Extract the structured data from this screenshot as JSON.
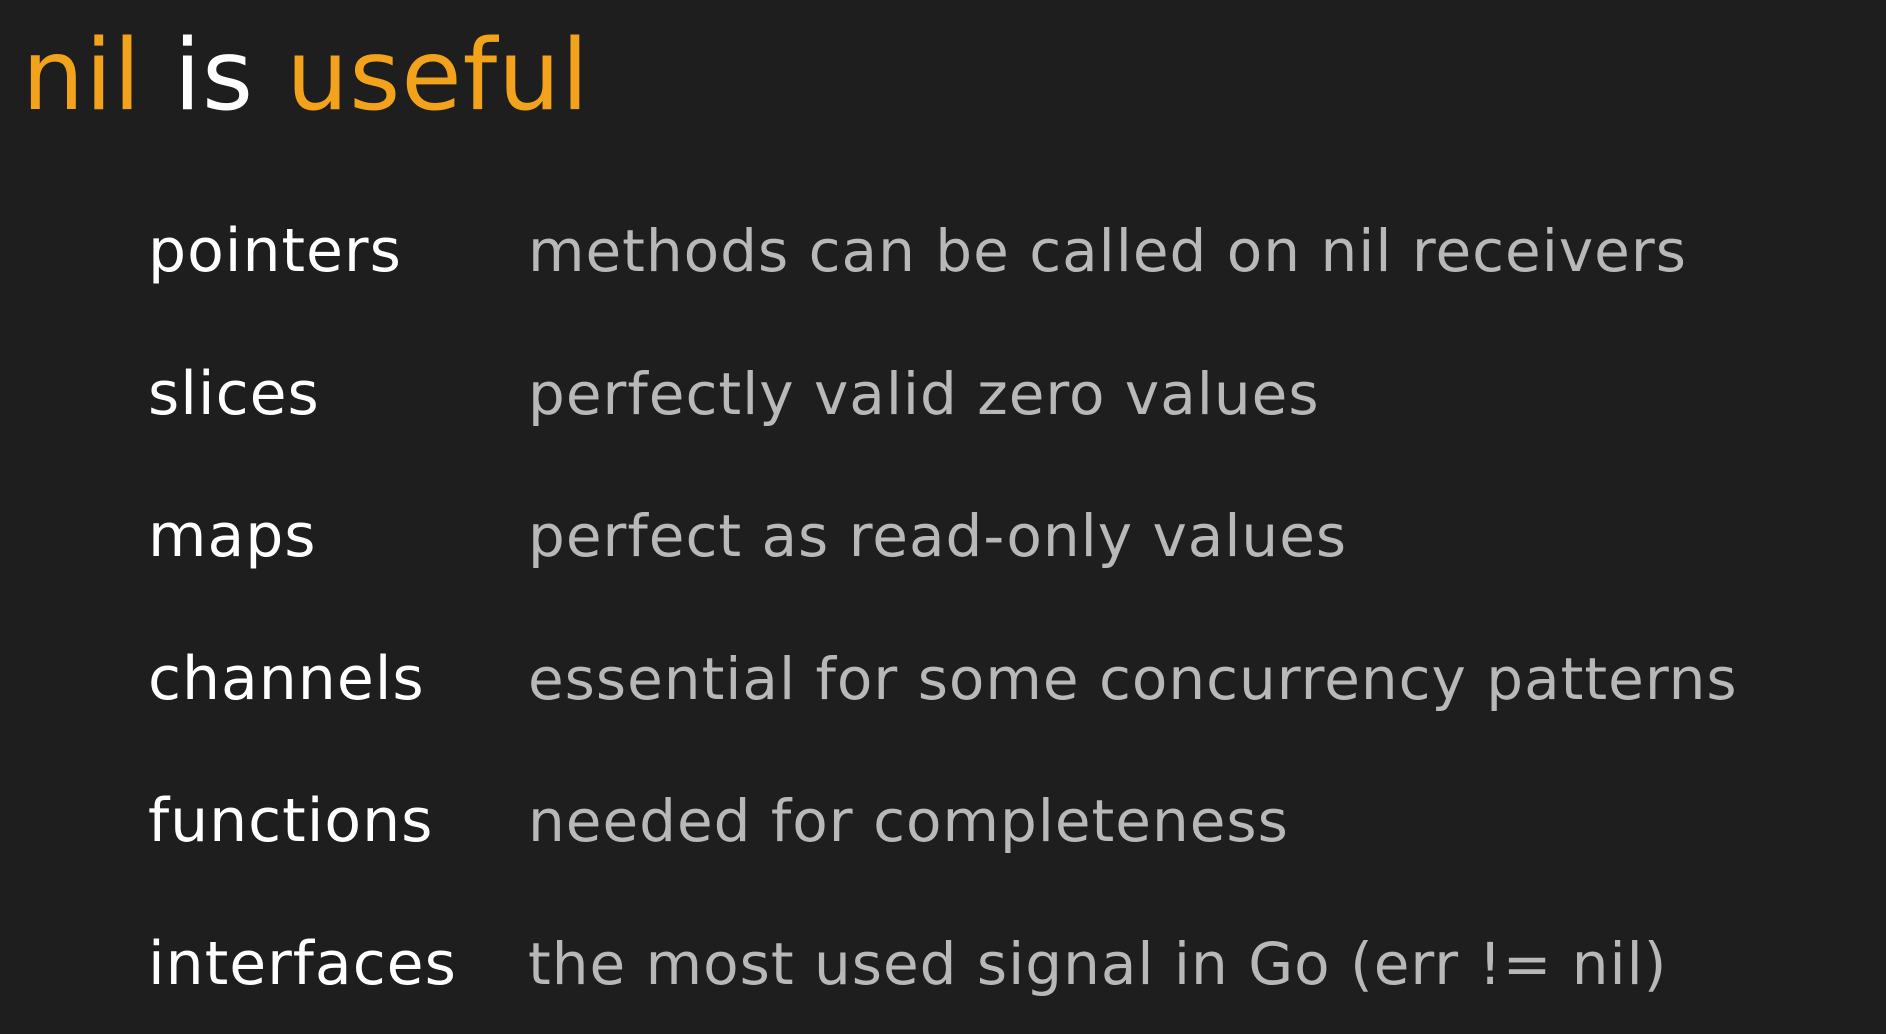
{
  "title": {
    "part1": "nil",
    "part2": "is",
    "part3": "useful"
  },
  "colors": {
    "background": "#1d1e1d",
    "accent": "#f2a31b",
    "term": "#ffffff",
    "description": "#b8b8b8"
  },
  "rows": [
    {
      "term": "pointers",
      "description": "methods can be called on nil receivers"
    },
    {
      "term": "slices",
      "description": "perfectly valid zero values"
    },
    {
      "term": "maps",
      "description": "perfect as read-only values"
    },
    {
      "term": "channels",
      "description": "essential for some concurrency patterns"
    },
    {
      "term": "functions",
      "description": "needed for completeness"
    },
    {
      "term": "interfaces",
      "description": "the most used signal in Go (err != nil)"
    }
  ]
}
